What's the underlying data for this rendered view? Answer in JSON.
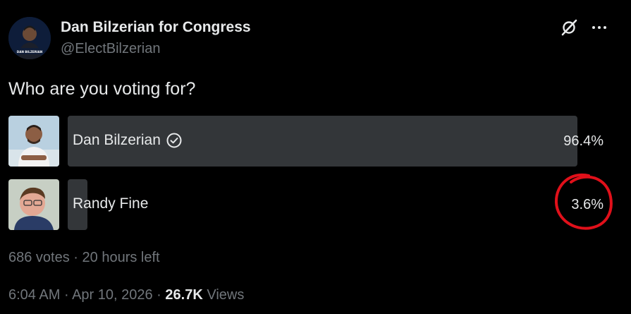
{
  "author": {
    "name": "Dan Bilzerian for Congress",
    "handle": "@ElectBilzerian",
    "avatar_caption": "DAN BILZERIAN"
  },
  "header": {
    "grok_icon": "grok-slash-icon",
    "more_icon": "more-dots-icon"
  },
  "poll": {
    "question": "Who are you voting for?",
    "options": [
      {
        "label": "Dan Bilzerian",
        "percent": "96.4%",
        "share": 0.964,
        "verified_icon": "check-circle-icon"
      },
      {
        "label": "Randy Fine",
        "percent": "3.6%",
        "share": 0.036
      }
    ],
    "votes": "686 votes",
    "separator": "·",
    "time_left": "20 hours left"
  },
  "footer": {
    "time": "6:04 AM",
    "separator": "·",
    "date": "Apr 10, 2026",
    "views_count": "26.7K",
    "views_label": "Views"
  },
  "colors": {
    "background": "#000000",
    "bar": "#333639",
    "text": "#e7e9ea",
    "muted": "#71767b",
    "annotation": "#e0101a"
  }
}
